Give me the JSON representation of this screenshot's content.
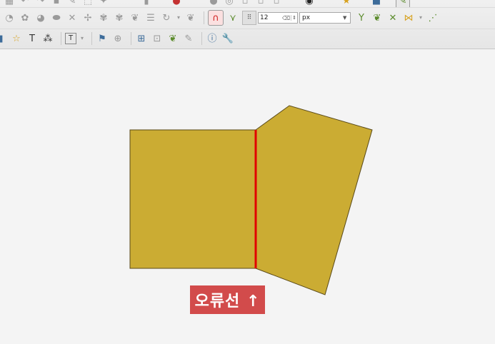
{
  "toolbar_top": {
    "icons": [
      "table-icon",
      "undo-icon",
      "redo-icon",
      "save-icon",
      "digitize-icon",
      "select-icon",
      "fill-icon",
      "color-icon",
      "vertex-icon",
      "node-icon",
      "bus-icon",
      "map-icon",
      "image-icon",
      "edit-icon"
    ]
  },
  "toolbar_advanced_digitizing": {
    "icons": [
      "add-ring-icon",
      "add-part-icon",
      "fill-ring-icon",
      "simplify-icon",
      "delete-ring-icon",
      "delete-part-icon",
      "reshape-icon",
      "offset-curve-icon",
      "split-features-icon",
      "split-parts-icon",
      "merge-icon",
      "rotate-icon"
    ],
    "snapping_tolerance_value": "12",
    "snapping_unit": "px"
  },
  "toolbar_labels": {
    "icons": [
      "add-point-icon",
      "star-icon",
      "text-label-icon",
      "multi-label-icon",
      "text-annotation-icon",
      "pin-icon",
      "crosshair-icon",
      "layer-add-icon",
      "globe-icon",
      "topology-icon",
      "pencil-icon",
      "info-icon",
      "wrench-icon"
    ],
    "text_button_label": "T"
  },
  "map": {
    "error_label": "오류선 ↑",
    "polygon_fill": "#cbac33",
    "polygon_stroke": "#5a4a1a",
    "error_line_color": "#e00000",
    "label_background": "#d24b4b"
  }
}
